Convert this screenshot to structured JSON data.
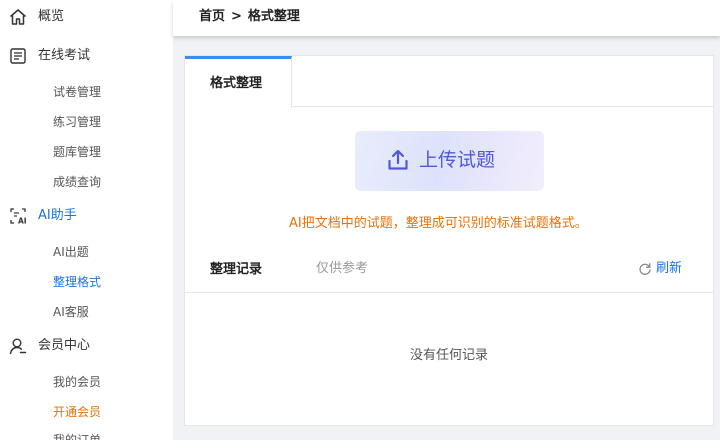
{
  "sidebar": {
    "overview": "概览",
    "online_exam": {
      "label": "在线考试",
      "items": [
        "试卷管理",
        "练习管理",
        "题库管理",
        "成绩查询"
      ]
    },
    "ai_assistant": {
      "label": "AI助手",
      "items": [
        "AI出题",
        "整理格式",
        "AI客服"
      ]
    },
    "member_center": {
      "label": "会员中心",
      "items": [
        "我的会员",
        "开通会员",
        "我的订单"
      ]
    }
  },
  "breadcrumb": {
    "home": "首页",
    "separator": ">",
    "current": "格式整理"
  },
  "main": {
    "tab_label": "格式整理",
    "upload_label": "上传试题",
    "hint": "AI把文档中的试题，整理成可识别的标准试题格式。",
    "records_title": "整理记录",
    "records_note": "仅供参考",
    "refresh_label": "刷新",
    "empty_text": "没有任何记录"
  },
  "colors": {
    "accent": "#1a73e8",
    "highlight": "#e8710a",
    "upload_text": "#4f5bd5",
    "tab_indicator": "#3d8bef"
  },
  "icons": {
    "overview": "home-icon",
    "online_exam": "exam-list-icon",
    "ai_assistant": "ai-doc-icon",
    "member_center": "user-icon",
    "upload": "upload-icon",
    "refresh": "refresh-icon"
  }
}
